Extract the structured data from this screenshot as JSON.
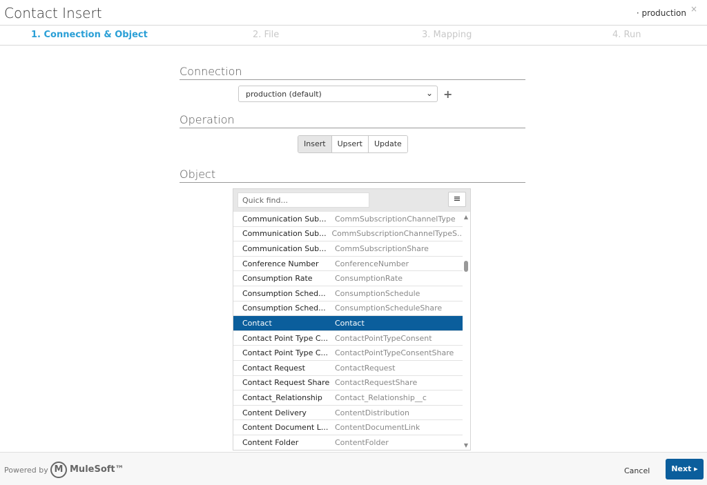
{
  "header": {
    "title": "Contact Insert",
    "environment": "· production",
    "close_icon": "×"
  },
  "steps": [
    {
      "label": "1. Connection & Object",
      "active": true
    },
    {
      "label": "2. File",
      "active": false
    },
    {
      "label": "3. Mapping",
      "active": false
    },
    {
      "label": "4. Run",
      "active": false
    }
  ],
  "connection": {
    "section_title": "Connection",
    "selected": "production (default)",
    "add_icon": "+"
  },
  "operation": {
    "section_title": "Operation",
    "buttons": [
      "Insert",
      "Upsert",
      "Update"
    ],
    "active": "Insert"
  },
  "object": {
    "section_title": "Object",
    "quick_find_placeholder": "Quick find...",
    "rows": [
      {
        "label": "Communication Sub...",
        "api": "CommSubscriptionChannelType"
      },
      {
        "label": "Communication Sub...",
        "api": "CommSubscriptionChannelTypeS..."
      },
      {
        "label": "Communication Sub...",
        "api": "CommSubscriptionShare"
      },
      {
        "label": "Conference Number",
        "api": "ConferenceNumber"
      },
      {
        "label": "Consumption Rate",
        "api": "ConsumptionRate"
      },
      {
        "label": "Consumption Sched...",
        "api": "ConsumptionSchedule"
      },
      {
        "label": "Consumption Sched...",
        "api": "ConsumptionScheduleShare"
      },
      {
        "label": "Contact",
        "api": "Contact",
        "selected": true
      },
      {
        "label": "Contact Point Type C...",
        "api": "ContactPointTypeConsent"
      },
      {
        "label": "Contact Point Type C...",
        "api": "ContactPointTypeConsentShare"
      },
      {
        "label": "Contact Request",
        "api": "ContactRequest"
      },
      {
        "label": "Contact Request Share",
        "api": "ContactRequestShare"
      },
      {
        "label": "Contact_Relationship",
        "api": "Contact_Relationship__c"
      },
      {
        "label": "Content Delivery",
        "api": "ContentDistribution"
      },
      {
        "label": "Content Document L...",
        "api": "ContentDocumentLink"
      },
      {
        "label": "Content Folder",
        "api": "ContentFolder"
      }
    ]
  },
  "footer": {
    "powered_by": "Powered by",
    "brand": "MuleSoft™",
    "brand_mark": "M",
    "cancel_label": "Cancel",
    "next_label": "Next ▸"
  },
  "colors": {
    "accent": "#2a9fd6",
    "selected_row": "#0b5e9c",
    "next_button": "#0b5e9c"
  }
}
